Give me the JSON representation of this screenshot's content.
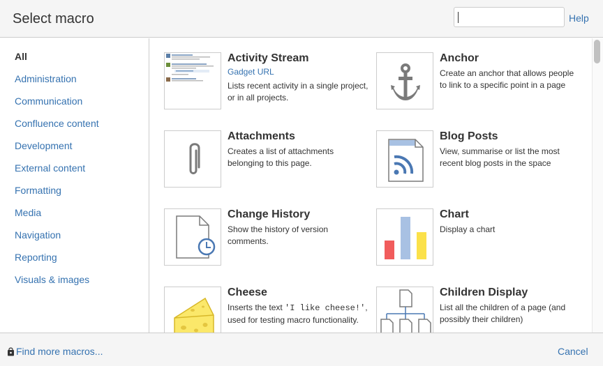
{
  "header": {
    "title": "Select macro",
    "search_value": "",
    "help_label": "Help"
  },
  "sidebar": {
    "categories": [
      {
        "label": "All",
        "active": true
      },
      {
        "label": "Administration"
      },
      {
        "label": "Communication"
      },
      {
        "label": "Confluence content"
      },
      {
        "label": "Development"
      },
      {
        "label": "External content"
      },
      {
        "label": "Formatting"
      },
      {
        "label": "Media"
      },
      {
        "label": "Navigation"
      },
      {
        "label": "Reporting"
      },
      {
        "label": "Visuals & images"
      }
    ]
  },
  "macros": [
    {
      "name": "Activity Stream",
      "subtitle": "Gadget URL",
      "description": "Lists recent activity in a single project, or in all projects.",
      "icon": "activity-stream-thumbnail"
    },
    {
      "name": "Anchor",
      "description": "Create an anchor that allows people to link to a specific point in a page",
      "icon": "anchor-icon"
    },
    {
      "name": "Attachments",
      "description": "Creates a list of attachments belonging to this page.",
      "icon": "paperclip-icon"
    },
    {
      "name": "Blog Posts",
      "description": "View, summarise or list the most recent blog posts in the space",
      "icon": "rss-document-icon"
    },
    {
      "name": "Change History",
      "description": "Show the history of version comments.",
      "icon": "document-clock-icon"
    },
    {
      "name": "Chart",
      "description": "Display a chart",
      "icon": "bar-chart-icon"
    },
    {
      "name": "Cheese",
      "description_prefix": "Inserts the text ",
      "description_code": "'I like cheese!'",
      "description_suffix": ", used for testing macro functionality.",
      "icon": "cheese-icon"
    },
    {
      "name": "Children Display",
      "description": "List all the children of a page (and possibly their children)",
      "icon": "page-tree-icon"
    }
  ],
  "footer": {
    "find_more_label": "Find more macros...",
    "cancel_label": "Cancel"
  },
  "colors": {
    "link": "#3572b0",
    "text": "#333333",
    "border": "#cccccc",
    "chart_red": "#f15c5c",
    "chart_blue": "#a8c1e3",
    "chart_yellow": "#fbe14a",
    "cheese": "#fbe86a"
  }
}
